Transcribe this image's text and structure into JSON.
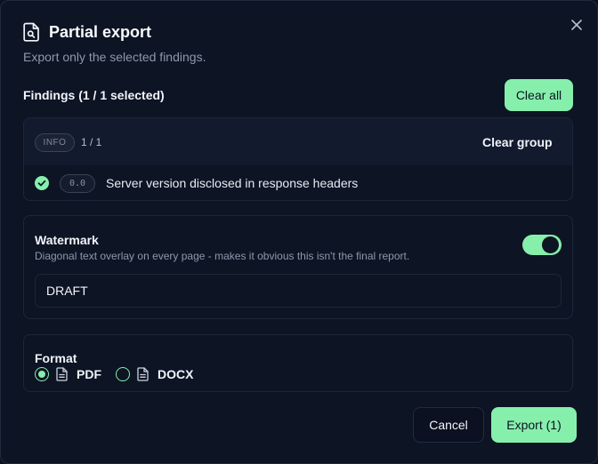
{
  "dialog": {
    "title": "Partial export",
    "subtitle": "Export only the selected findings."
  },
  "findings": {
    "label": "Findings (1 / 1 selected)",
    "clear_all_label": "Clear all",
    "group": {
      "severity": "INFO",
      "count": "1 / 1",
      "clear_label": "Clear group",
      "items": [
        {
          "score": "0.0",
          "title": "Server version disclosed in response headers",
          "checked": true
        }
      ]
    }
  },
  "watermark": {
    "title": "Watermark",
    "description": "Diagonal text overlay on every page - makes it obvious this isn't the final report.",
    "enabled": true,
    "value": "DRAFT"
  },
  "format": {
    "title": "Format",
    "options": [
      {
        "label": "PDF",
        "selected": true
      },
      {
        "label": "DOCX",
        "selected": false
      }
    ]
  },
  "actions": {
    "cancel_label": "Cancel",
    "export_label": "Export (1)"
  },
  "colors": {
    "accent": "#86efac",
    "background": "#0d1424",
    "panel": "#121a2e",
    "border": "#1e2738",
    "muted_text": "#8e98ab"
  },
  "icons": {
    "title": "file-search-icon",
    "close": "close-icon",
    "check": "check-circle-icon",
    "file": "file-text-icon"
  }
}
